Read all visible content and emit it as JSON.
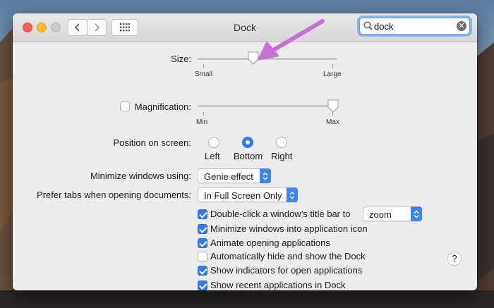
{
  "window": {
    "title": "Dock"
  },
  "toolbar": {
    "back_icon": "chevron-left-icon",
    "forward_icon": "chevron-right-icon",
    "grid_icon": "grid-icon"
  },
  "search": {
    "value": "dock",
    "icon": "search-icon",
    "clear_icon": "clear-icon"
  },
  "size": {
    "label": "Size:",
    "min_label": "Small",
    "max_label": "Large",
    "value": 0.4
  },
  "magnification": {
    "label": "Magnification:",
    "checked": false,
    "min_label": "Min",
    "max_label": "Max",
    "value": 0.97
  },
  "position": {
    "label": "Position on screen:",
    "options": [
      "Left",
      "Bottom",
      "Right"
    ],
    "selected": "Bottom"
  },
  "minimize": {
    "label": "Minimize windows using:",
    "value": "Genie effect"
  },
  "prefer_tabs": {
    "label": "Prefer tabs when opening documents:",
    "value": "In Full Screen Only"
  },
  "checkboxes": [
    {
      "label": "Double-click a window’s title bar to",
      "checked": true
    },
    {
      "label": "Minimize windows into application icon",
      "checked": true
    },
    {
      "label": "Animate opening applications",
      "checked": true
    },
    {
      "label": "Automatically hide and show the Dock",
      "checked": false
    },
    {
      "label": "Show indicators for open applications",
      "checked": true
    },
    {
      "label": "Show recent applications in Dock",
      "checked": true
    }
  ],
  "double_click_action": {
    "value": "zoom"
  },
  "help": {
    "label": "?"
  },
  "colors": {
    "accent": "#2f7cf6",
    "annotation_arrow": "#c86fd6"
  }
}
